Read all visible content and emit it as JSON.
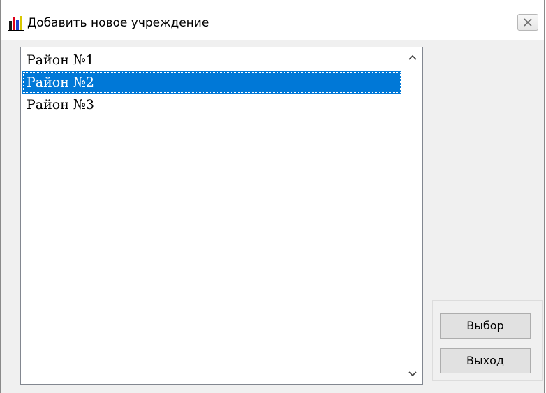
{
  "window": {
    "title": "Добавить новое учреждение",
    "icon": "bar-chart-app-icon",
    "close_icon": "close-icon"
  },
  "list": {
    "items": [
      {
        "label": "Район №1",
        "selected": false
      },
      {
        "label": "Район №2",
        "selected": true
      },
      {
        "label": "Район №3",
        "selected": false
      }
    ],
    "selection_color": "#0078d7"
  },
  "buttons": {
    "select_label": "Выбор",
    "exit_label": "Выход"
  }
}
